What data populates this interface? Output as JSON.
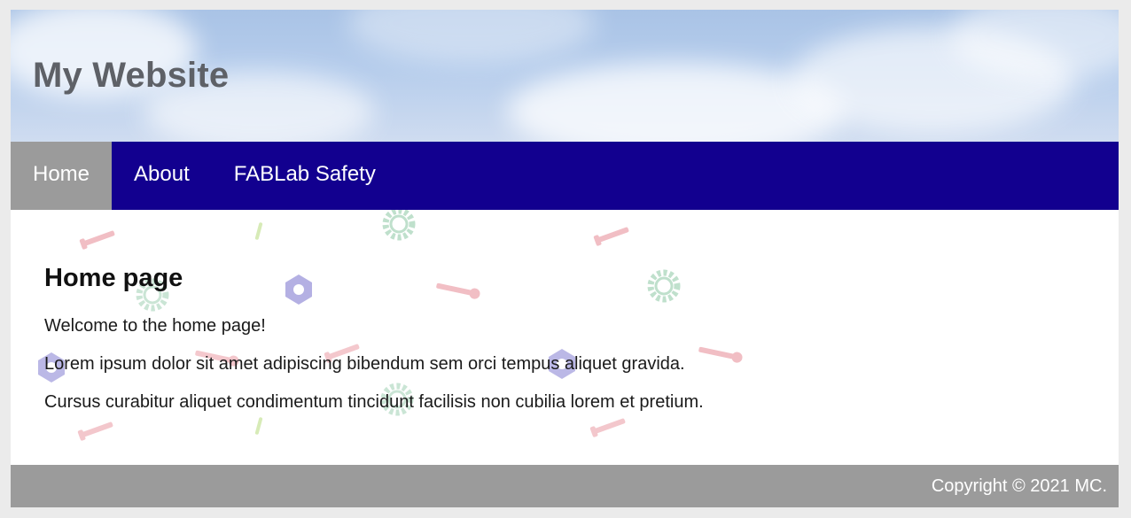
{
  "site": {
    "title": "My Website"
  },
  "nav": {
    "items": [
      {
        "label": "Home",
        "active": true
      },
      {
        "label": "About",
        "active": false
      },
      {
        "label": "FABLab Safety",
        "active": false
      }
    ],
    "colors": {
      "bar": "#12008f",
      "active": "#9b9b9b",
      "text": "#ffffff"
    }
  },
  "main": {
    "heading": "Home page",
    "paragraphs": [
      "Welcome to the home page!",
      "Lorem ipsum dolor sit amet adipiscing bibendum sem orci tempus aliquet gravida.",
      "Cursus curabitur aliquet condimentum tincidunt facilisis non cubilia lorem et pretium."
    ],
    "background_pattern": [
      "screw-icon",
      "hex-nut-icon",
      "gear-icon",
      "wrench-icon"
    ]
  },
  "footer": {
    "copyright": "Copyright © 2021 MC.",
    "color": "#9b9b9b"
  }
}
